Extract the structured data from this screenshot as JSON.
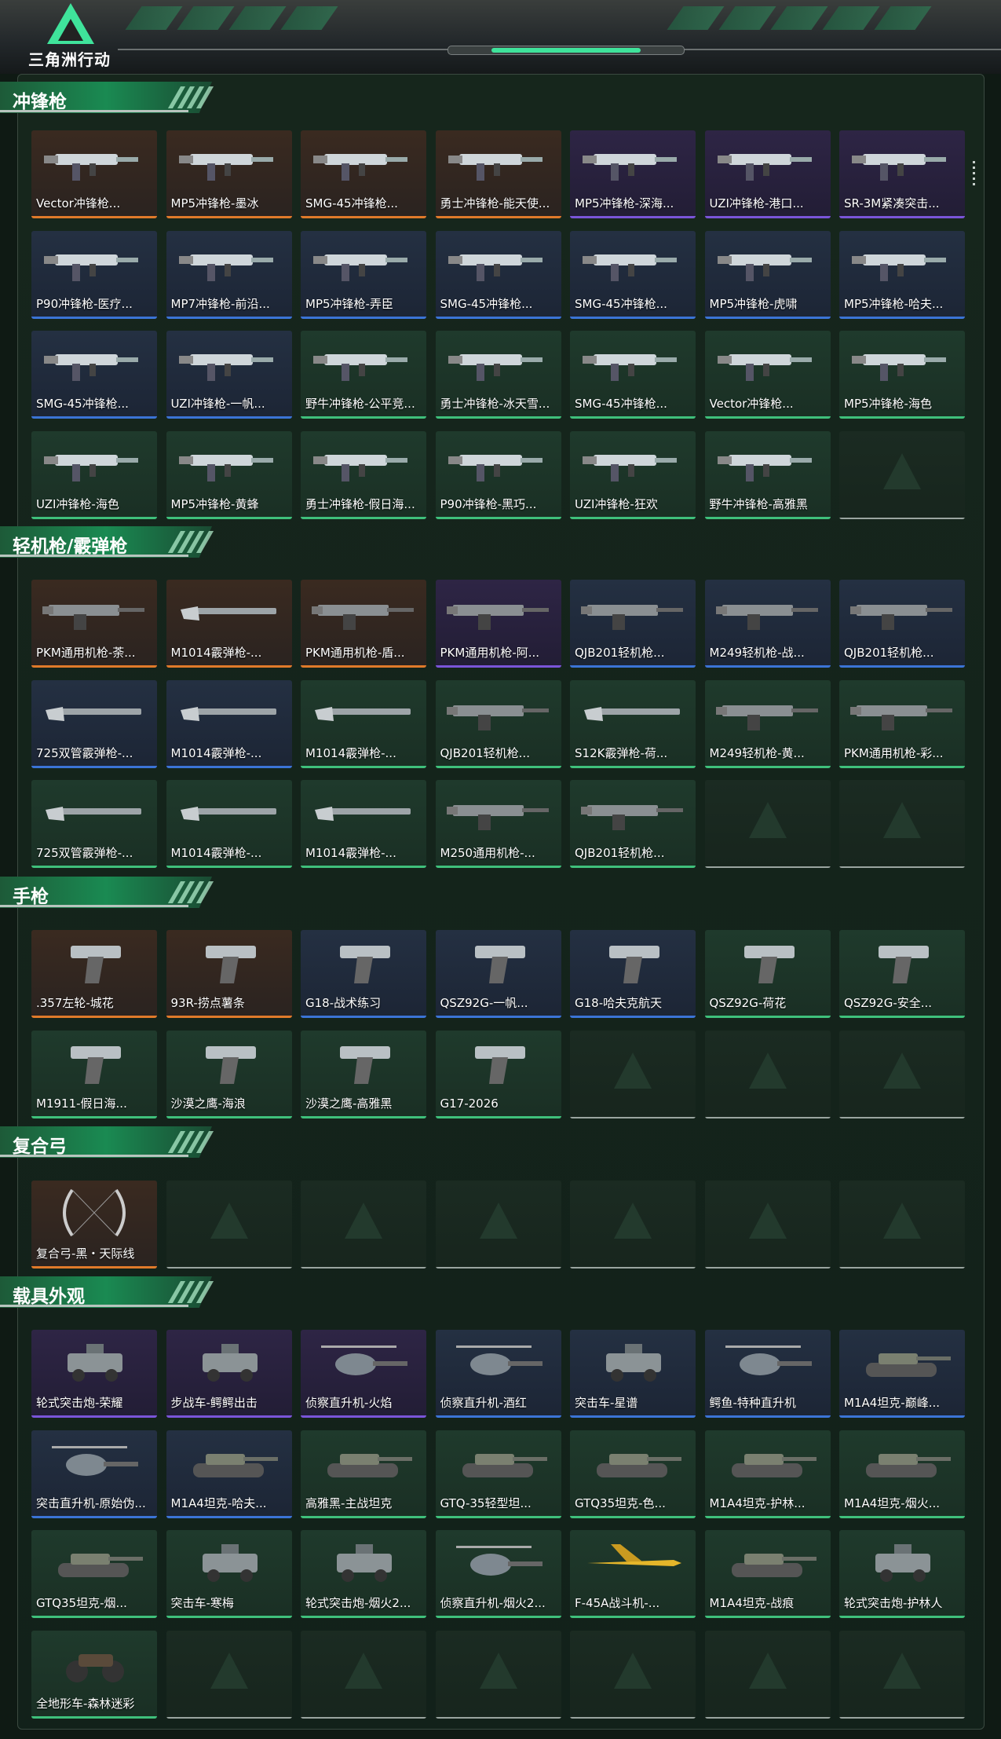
{
  "app": {
    "title": "三角洲行动"
  },
  "sections": [
    {
      "title": "冲锋枪",
      "items": [
        {
          "label": "Vector冲锋枪...",
          "rarity": "orange",
          "icon": "smg-icon"
        },
        {
          "label": "MP5冲锋枪-墨冰",
          "rarity": "orange",
          "icon": "smg-icon"
        },
        {
          "label": "SMG-45冲锋枪...",
          "rarity": "orange",
          "icon": "smg-icon"
        },
        {
          "label": "勇士冲锋枪-能天使...",
          "rarity": "orange",
          "icon": "smg-icon"
        },
        {
          "label": "MP5冲锋枪-深海...",
          "rarity": "purple",
          "icon": "smg-icon"
        },
        {
          "label": "UZI冲锋枪-港口...",
          "rarity": "purple",
          "icon": "smg-icon"
        },
        {
          "label": "SR-3M紧凑突击...",
          "rarity": "purple",
          "icon": "smg-icon"
        },
        {
          "label": "P90冲锋枪-医疗...",
          "rarity": "blue",
          "icon": "smg-icon"
        },
        {
          "label": "MP7冲锋枪-前沿...",
          "rarity": "blue",
          "icon": "smg-icon"
        },
        {
          "label": "MP5冲锋枪-弄臣",
          "rarity": "blue",
          "icon": "smg-icon"
        },
        {
          "label": "SMG-45冲锋枪...",
          "rarity": "blue",
          "icon": "smg-icon"
        },
        {
          "label": "SMG-45冲锋枪...",
          "rarity": "blue",
          "icon": "smg-icon"
        },
        {
          "label": "MP5冲锋枪-虎啸",
          "rarity": "blue",
          "icon": "smg-icon"
        },
        {
          "label": "MP5冲锋枪-哈夫...",
          "rarity": "blue",
          "icon": "smg-icon"
        },
        {
          "label": "SMG-45冲锋枪...",
          "rarity": "blue",
          "icon": "smg-icon"
        },
        {
          "label": "UZI冲锋枪-一帆...",
          "rarity": "blue",
          "icon": "smg-icon"
        },
        {
          "label": "野牛冲锋枪-公平竞...",
          "rarity": "green",
          "icon": "smg-icon"
        },
        {
          "label": "勇士冲锋枪-冰天雪...",
          "rarity": "green",
          "icon": "smg-icon"
        },
        {
          "label": "SMG-45冲锋枪...",
          "rarity": "green",
          "icon": "smg-icon"
        },
        {
          "label": "Vector冲锋枪...",
          "rarity": "green",
          "icon": "smg-icon"
        },
        {
          "label": "MP5冲锋枪-海色",
          "rarity": "green",
          "icon": "smg-icon"
        },
        {
          "label": "UZI冲锋枪-海色",
          "rarity": "green",
          "icon": "smg-icon"
        },
        {
          "label": "MP5冲锋枪-黄蜂",
          "rarity": "green",
          "icon": "smg-icon"
        },
        {
          "label": "勇士冲锋枪-假日海...",
          "rarity": "green",
          "icon": "smg-icon"
        },
        {
          "label": "P90冲锋枪-黑巧...",
          "rarity": "green",
          "icon": "smg-icon"
        },
        {
          "label": "UZI冲锋枪-狂欢",
          "rarity": "green",
          "icon": "smg-icon"
        },
        {
          "label": "野牛冲锋枪-高雅黑",
          "rarity": "green",
          "icon": "smg-icon"
        },
        {
          "label": "",
          "rarity": "empty",
          "icon": ""
        }
      ]
    },
    {
      "title": "轻机枪/霰弹枪",
      "items": [
        {
          "label": "PKM通用机枪-荼...",
          "rarity": "orange",
          "icon": "lmg-icon"
        },
        {
          "label": "M1014霰弹枪-...",
          "rarity": "orange",
          "icon": "shotgun-icon"
        },
        {
          "label": "PKM通用机枪-盾...",
          "rarity": "orange",
          "icon": "lmg-icon"
        },
        {
          "label": "PKM通用机枪-阿...",
          "rarity": "purple",
          "icon": "lmg-icon"
        },
        {
          "label": "QJB201轻机枪...",
          "rarity": "blue",
          "icon": "lmg-icon"
        },
        {
          "label": "M249轻机枪-战...",
          "rarity": "blue",
          "icon": "lmg-icon"
        },
        {
          "label": "QJB201轻机枪...",
          "rarity": "blue",
          "icon": "lmg-icon"
        },
        {
          "label": "725双管霰弹枪-...",
          "rarity": "blue",
          "icon": "shotgun-icon"
        },
        {
          "label": "M1014霰弹枪-...",
          "rarity": "blue",
          "icon": "shotgun-icon"
        },
        {
          "label": "M1014霰弹枪-...",
          "rarity": "green",
          "icon": "shotgun-icon"
        },
        {
          "label": "QJB201轻机枪...",
          "rarity": "green",
          "icon": "lmg-icon"
        },
        {
          "label": "S12K霰弹枪-荷...",
          "rarity": "green",
          "icon": "shotgun-icon"
        },
        {
          "label": "M249轻机枪-黄...",
          "rarity": "green",
          "icon": "lmg-icon"
        },
        {
          "label": "PKM通用机枪-彩...",
          "rarity": "green",
          "icon": "lmg-icon"
        },
        {
          "label": "725双管霰弹枪-...",
          "rarity": "green",
          "icon": "shotgun-icon"
        },
        {
          "label": "M1014霰弹枪-...",
          "rarity": "green",
          "icon": "shotgun-icon"
        },
        {
          "label": "M1014霰弹枪-...",
          "rarity": "green",
          "icon": "shotgun-icon"
        },
        {
          "label": "M250通用机枪-...",
          "rarity": "green",
          "icon": "lmg-icon"
        },
        {
          "label": "QJB201轻机枪...",
          "rarity": "green",
          "icon": "lmg-icon"
        },
        {
          "label": "",
          "rarity": "empty",
          "icon": ""
        },
        {
          "label": "",
          "rarity": "empty",
          "icon": ""
        }
      ]
    },
    {
      "title": "手枪",
      "items": [
        {
          "label": ".357左轮-城花",
          "rarity": "orange",
          "icon": "pistol-icon"
        },
        {
          "label": "93R-捞点薯条",
          "rarity": "orange",
          "icon": "pistol-icon"
        },
        {
          "label": "G18-战术练习",
          "rarity": "blue",
          "icon": "pistol-icon"
        },
        {
          "label": "QSZ92G-一帆...",
          "rarity": "blue",
          "icon": "pistol-icon"
        },
        {
          "label": "G18-哈夫克航天",
          "rarity": "blue",
          "icon": "pistol-icon"
        },
        {
          "label": "QSZ92G-荷花",
          "rarity": "green",
          "icon": "pistol-icon"
        },
        {
          "label": "QSZ92G-安全...",
          "rarity": "green",
          "icon": "pistol-icon"
        },
        {
          "label": "M1911-假日海...",
          "rarity": "green",
          "icon": "pistol-icon"
        },
        {
          "label": "沙漠之鹰-海浪",
          "rarity": "green",
          "icon": "pistol-icon"
        },
        {
          "label": "沙漠之鹰-高雅黑",
          "rarity": "green",
          "icon": "pistol-icon"
        },
        {
          "label": "G17-2026",
          "rarity": "green",
          "icon": "pistol-icon"
        },
        {
          "label": "",
          "rarity": "empty",
          "icon": ""
        },
        {
          "label": "",
          "rarity": "empty",
          "icon": ""
        },
        {
          "label": "",
          "rarity": "empty",
          "icon": ""
        }
      ]
    },
    {
      "title": "复合弓",
      "items": [
        {
          "label": "复合弓-黑・天际线",
          "rarity": "orange",
          "icon": "bow-icon"
        },
        {
          "label": "",
          "rarity": "empty",
          "icon": ""
        },
        {
          "label": "",
          "rarity": "empty",
          "icon": ""
        },
        {
          "label": "",
          "rarity": "empty",
          "icon": ""
        },
        {
          "label": "",
          "rarity": "empty",
          "icon": ""
        },
        {
          "label": "",
          "rarity": "empty",
          "icon": ""
        },
        {
          "label": "",
          "rarity": "empty",
          "icon": ""
        }
      ]
    },
    {
      "title": "载具外观",
      "items": [
        {
          "label": "轮式突击炮-荣耀",
          "rarity": "purple",
          "icon": "vehicle-icon"
        },
        {
          "label": "步战车-鳄鳄出击",
          "rarity": "purple",
          "icon": "vehicle-icon"
        },
        {
          "label": "侦察直升机-火焰",
          "rarity": "purple",
          "icon": "helicopter-icon"
        },
        {
          "label": "侦察直升机-酒红",
          "rarity": "blue",
          "icon": "helicopter-icon"
        },
        {
          "label": "突击车-星谱",
          "rarity": "blue",
          "icon": "vehicle-icon"
        },
        {
          "label": "鳄鱼-特种直升机",
          "rarity": "blue",
          "icon": "helicopter-icon"
        },
        {
          "label": "M1A4坦克-巅峰...",
          "rarity": "blue",
          "icon": "tank-icon"
        },
        {
          "label": "突击直升机-原始伪...",
          "rarity": "blue",
          "icon": "helicopter-icon"
        },
        {
          "label": "M1A4坦克-哈夫...",
          "rarity": "blue",
          "icon": "tank-icon"
        },
        {
          "label": "高雅黑-主战坦克",
          "rarity": "green",
          "icon": "tank-icon"
        },
        {
          "label": "GTQ-35轻型坦...",
          "rarity": "green",
          "icon": "tank-icon"
        },
        {
          "label": "GTQ35坦克-色...",
          "rarity": "green",
          "icon": "tank-icon"
        },
        {
          "label": "M1A4坦克-护林...",
          "rarity": "green",
          "icon": "tank-icon"
        },
        {
          "label": "M1A4坦克-烟火...",
          "rarity": "green",
          "icon": "tank-icon"
        },
        {
          "label": "GTQ35坦克-烟...",
          "rarity": "green",
          "icon": "tank-icon"
        },
        {
          "label": "突击车-寒梅",
          "rarity": "green",
          "icon": "vehicle-icon"
        },
        {
          "label": "轮式突击炮-烟火2...",
          "rarity": "green",
          "icon": "vehicle-icon"
        },
        {
          "label": "侦察直升机-烟火2...",
          "rarity": "green",
          "icon": "helicopter-icon"
        },
        {
          "label": "F-45A战斗机-...",
          "rarity": "green",
          "icon": "jet-icon"
        },
        {
          "label": "M1A4坦克-战痕",
          "rarity": "green",
          "icon": "tank-icon"
        },
        {
          "label": "轮式突击炮-护林人",
          "rarity": "green",
          "icon": "vehicle-icon"
        },
        {
          "label": "全地形车-森林迷彩",
          "rarity": "green",
          "icon": "atv-icon"
        },
        {
          "label": "",
          "rarity": "empty",
          "icon": ""
        },
        {
          "label": "",
          "rarity": "empty",
          "icon": ""
        },
        {
          "label": "",
          "rarity": "empty",
          "icon": ""
        },
        {
          "label": "",
          "rarity": "empty",
          "icon": ""
        },
        {
          "label": "",
          "rarity": "empty",
          "icon": ""
        },
        {
          "label": "",
          "rarity": "empty",
          "icon": ""
        }
      ]
    }
  ],
  "colors": {
    "orange": "#e07a2a",
    "purple": "#7a55d8",
    "blue": "#3b74d6",
    "green": "#3fc07b",
    "accent": "#3fe39b"
  }
}
